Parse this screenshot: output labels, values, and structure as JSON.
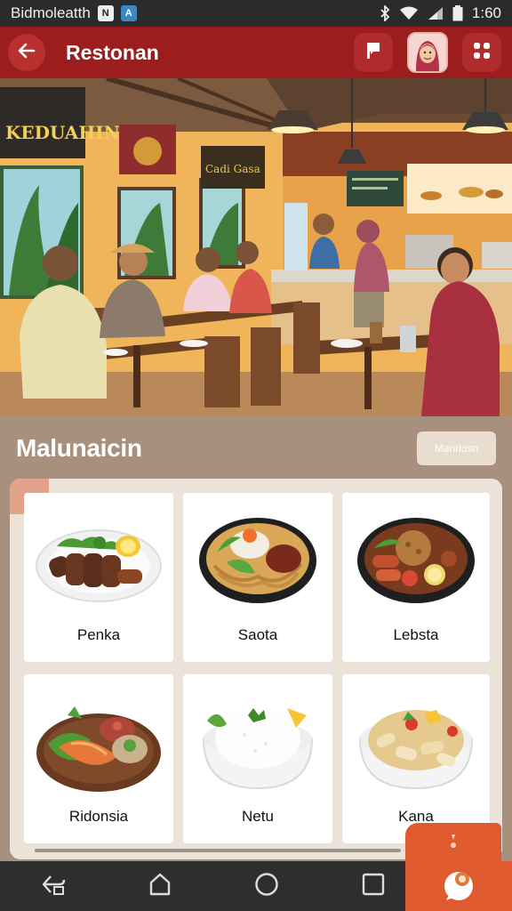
{
  "status_bar": {
    "app_name": "Bidmoleatth",
    "badge_1": "N",
    "badge_2": "A",
    "time": "1:60"
  },
  "app_bar": {
    "title": "Restonan"
  },
  "hero": {
    "sign_text": "KEDUAHIN",
    "poster_text": "Cadi Gasa"
  },
  "section": {
    "title": "Malunaicin",
    "button_label": "Manrlosn"
  },
  "menu_items": [
    {
      "label": "Penka",
      "icon": "grilled-meat-icon"
    },
    {
      "label": "Saota",
      "icon": "noodle-bowl-icon"
    },
    {
      "label": "Lebsta",
      "icon": "meatball-bowl-icon"
    },
    {
      "label": "Ridonsia",
      "icon": "fish-platter-icon"
    },
    {
      "label": "Netu",
      "icon": "rice-bowl-icon"
    },
    {
      "label": "Kana",
      "icon": "pasta-bowl-icon"
    }
  ],
  "colors": {
    "primary": "#9c1d1d",
    "accent": "#e05a2f",
    "background": "#a8907f",
    "panel": "#ebe3d8"
  }
}
